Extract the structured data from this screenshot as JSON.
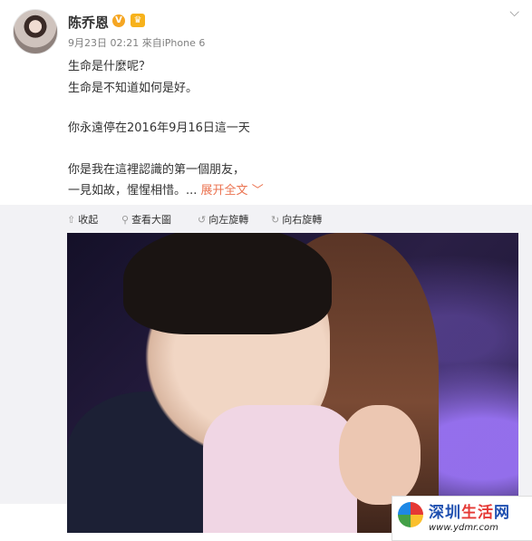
{
  "post": {
    "author": "陈乔恩",
    "verified_badge": "V",
    "member_badge": "♛",
    "timestamp": "9月23日 02:21",
    "source": "來自iPhone 6",
    "lines": [
      "生命是什麼呢？",
      "生命是不知道如何是好。",
      "",
      "你永遠停在2016年9月16日這一天",
      "",
      "你是我在這裡認識的第一個朋友，",
      "一見如故，惺惺相惜。..."
    ],
    "expand_label": "展开全文",
    "expand_icon": "﹀"
  },
  "toolbar": {
    "collapse": {
      "icon": "⇧",
      "label": "收起"
    },
    "view_large": {
      "icon": "⚲",
      "label": "查看大圖"
    },
    "rotate_left": {
      "icon": "↺",
      "label": "向左旋轉"
    },
    "rotate_right": {
      "icon": "↻",
      "label": "向右旋轉"
    }
  },
  "watermark": {
    "title_part1": "深圳",
    "title_part2": "生活",
    "title_part3": "网",
    "url": "www.ydmr.com"
  }
}
